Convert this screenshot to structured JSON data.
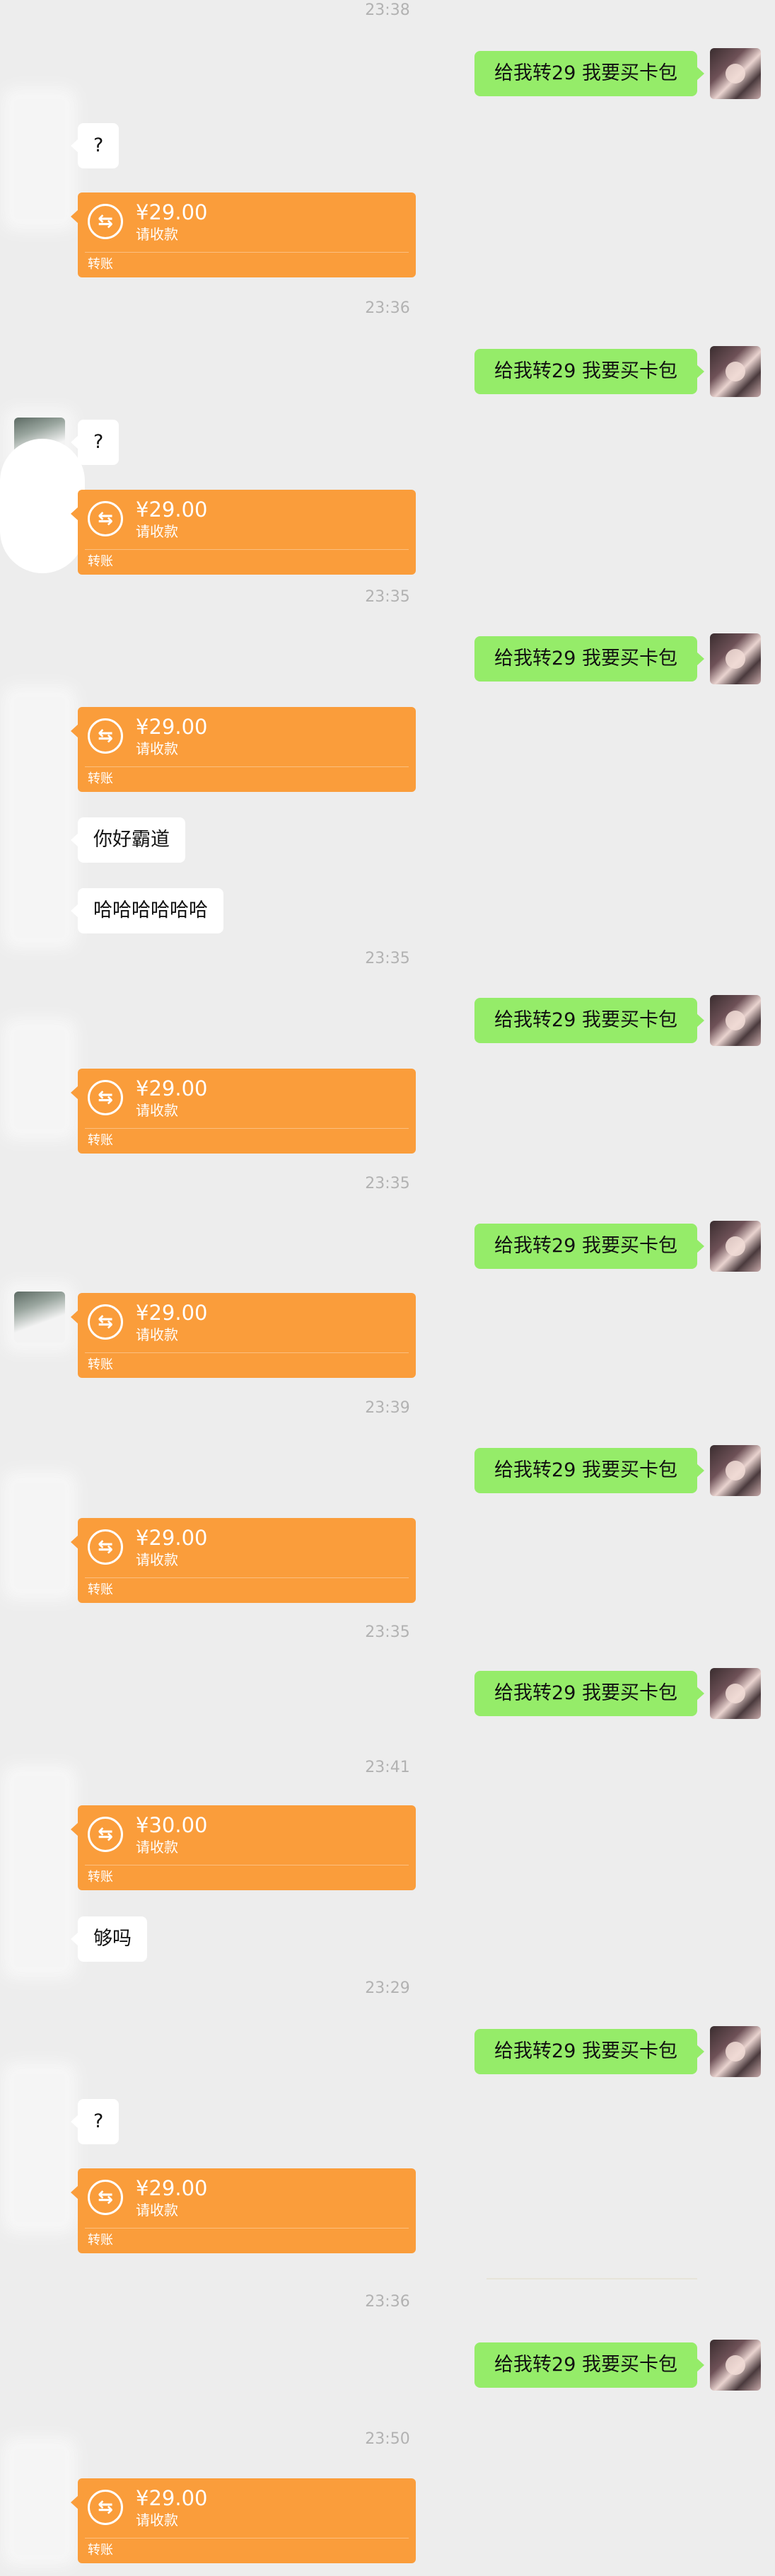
{
  "request_text": "给我转29  我要买卡包",
  "transfer_sub": "请收款",
  "transfer_foot": "转账",
  "times": [
    "23:38",
    "23:36",
    "23:35",
    "23:35",
    "23:35",
    "23:39",
    "23:35",
    "23:41",
    "23:29",
    "23:36",
    "23:50"
  ],
  "replies": {
    "q1": "?",
    "q2": "?",
    "domineering": "你好霸道",
    "laugh": "哈哈哈哈哈哈",
    "enough": "够吗",
    "q3": "?"
  },
  "amounts": [
    "¥29.00",
    "¥29.00",
    "¥29.00",
    "¥29.00",
    "¥29.00",
    "¥29.00",
    "¥30.00",
    "¥29.00",
    "¥29.00"
  ],
  "icons": {
    "transfer": "transfer-arrows-icon"
  },
  "colors": {
    "background": "#ededed",
    "sent_bubble": "#95ec69",
    "received_bubble": "#ffffff",
    "transfer_card": "#fa9d3b",
    "timestamp": "#b2b2b2"
  }
}
